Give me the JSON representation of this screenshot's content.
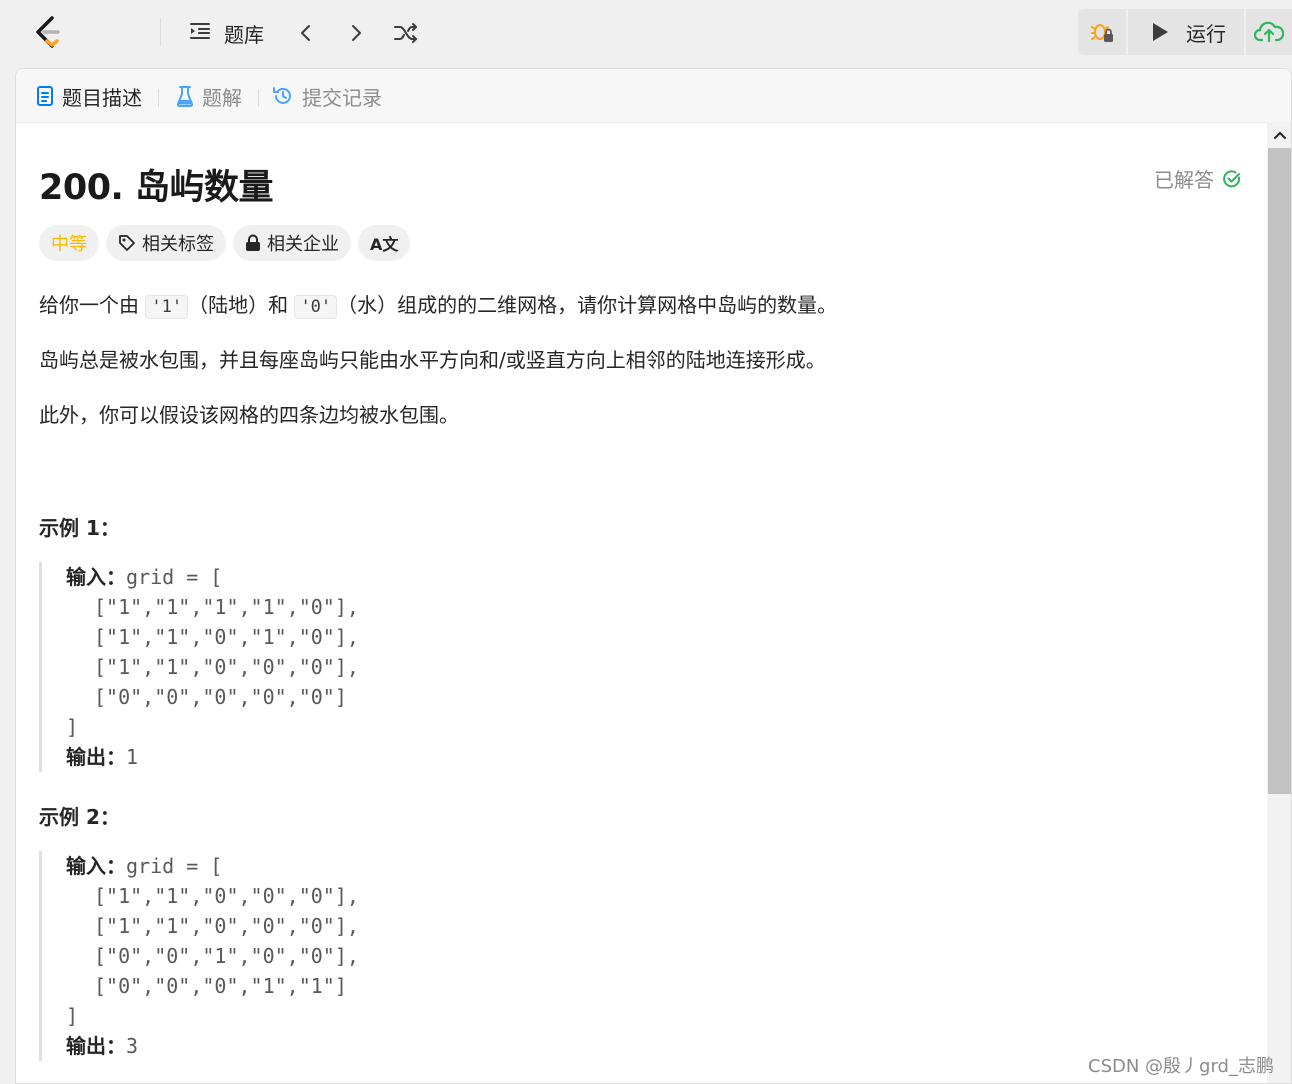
{
  "nav": {
    "problems_label": "题库",
    "run_label": "运行"
  },
  "tabs": [
    {
      "label": "题目描述"
    },
    {
      "label": "题解"
    },
    {
      "label": "提交记录"
    }
  ],
  "problem": {
    "title": "200. 岛屿数量",
    "status": "已解答",
    "tags": {
      "difficulty": "中等",
      "related_tags": "相关标签",
      "related_companies": "相关企业",
      "translate": "A文"
    },
    "desc": {
      "p1_a": "给你一个由 ",
      "p1_code1": "'1'",
      "p1_b": "（陆地）和 ",
      "p1_code2": "'0'",
      "p1_c": "（水）组成的的二维网格，请你计算网格中岛屿的数量。",
      "p2": "岛屿总是被水包围，并且每座岛屿只能由水平方向和/或竖直方向上相邻的陆地连接形成。",
      "p3": "此外，你可以假设该网格的四条边均被水包围。"
    },
    "examples": [
      {
        "title": "示例 1：",
        "input_label": "输入：",
        "input_head": "grid = [",
        "rows": [
          "[\"1\",\"1\",\"1\",\"1\",\"0\"],",
          "[\"1\",\"1\",\"0\",\"1\",\"0\"],",
          "[\"1\",\"1\",\"0\",\"0\",\"0\"],",
          "[\"0\",\"0\",\"0\",\"0\",\"0\"]"
        ],
        "close": "]",
        "output_label": "输出：",
        "output": "1"
      },
      {
        "title": "示例 2：",
        "input_label": "输入：",
        "input_head": "grid = [",
        "rows": [
          "[\"1\",\"1\",\"0\",\"0\",\"0\"],",
          "[\"1\",\"1\",\"0\",\"0\",\"0\"],",
          "[\"0\",\"0\",\"1\",\"0\",\"0\"],",
          "[\"0\",\"0\",\"0\",\"1\",\"1\"]"
        ],
        "close": "]",
        "output_label": "输出：",
        "output": "3"
      }
    ]
  },
  "watermark": "CSDN @殷丿grd_志鹏",
  "colors": {
    "accent_blue": "#007aff",
    "medium_orange": "#ffb800",
    "solved_green": "#2db55d",
    "submit_green": "#2db55d"
  }
}
